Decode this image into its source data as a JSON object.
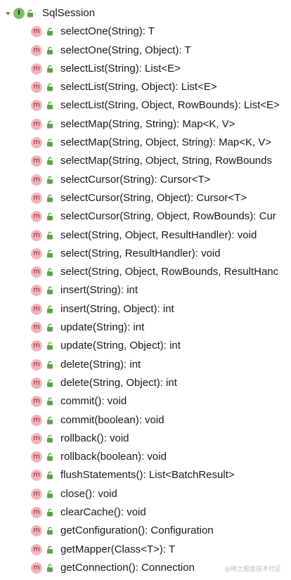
{
  "tree": {
    "root": {
      "label": "SqlSession",
      "badge": "I",
      "expand_icon": "chevron-down-icon",
      "visibility_icon": "unlock-icon"
    },
    "method_badge": "m",
    "methods": [
      "selectOne(String): T",
      "selectOne(String, Object): T",
      "selectList(String): List<E>",
      "selectList(String, Object): List<E>",
      "selectList(String, Object, RowBounds): List<E>",
      "selectMap(String, String): Map<K, V>",
      "selectMap(String, Object, String): Map<K, V>",
      "selectMap(String, Object, String, RowBounds",
      "selectCursor(String): Cursor<T>",
      "selectCursor(String, Object): Cursor<T>",
      "selectCursor(String, Object, RowBounds): Cur",
      "select(String, Object, ResultHandler): void",
      "select(String, ResultHandler): void",
      "select(String, Object, RowBounds, ResultHanc",
      "insert(String): int",
      "insert(String, Object): int",
      "update(String): int",
      "update(String, Object): int",
      "delete(String): int",
      "delete(String, Object): int",
      "commit(): void",
      "commit(boolean): void",
      "rollback(): void",
      "rollback(boolean): void",
      "flushStatements(): List<BatchResult>",
      "close(): void",
      "clearCache(): void",
      "getConfiguration(): Configuration",
      "getMapper(Class<T>): T",
      "getConnection(): Connection"
    ]
  },
  "watermark": {
    "text": "@稀土掘金技术社区"
  },
  "colors": {
    "interface_badge": "#7bbf6a",
    "method_badge": "#f2b4b9",
    "lock_green": "#5aa24a",
    "text": "#1a1a1a"
  }
}
